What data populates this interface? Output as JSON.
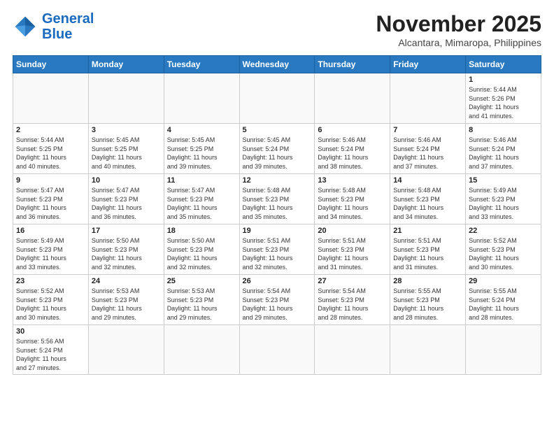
{
  "header": {
    "logo_general": "General",
    "logo_blue": "Blue",
    "month": "November 2025",
    "location": "Alcantara, Mimaropa, Philippines"
  },
  "weekdays": [
    "Sunday",
    "Monday",
    "Tuesday",
    "Wednesday",
    "Thursday",
    "Friday",
    "Saturday"
  ],
  "weeks": [
    [
      {
        "day": "",
        "info": ""
      },
      {
        "day": "",
        "info": ""
      },
      {
        "day": "",
        "info": ""
      },
      {
        "day": "",
        "info": ""
      },
      {
        "day": "",
        "info": ""
      },
      {
        "day": "",
        "info": ""
      },
      {
        "day": "1",
        "info": "Sunrise: 5:44 AM\nSunset: 5:26 PM\nDaylight: 11 hours\nand 41 minutes."
      }
    ],
    [
      {
        "day": "2",
        "info": "Sunrise: 5:44 AM\nSunset: 5:25 PM\nDaylight: 11 hours\nand 40 minutes."
      },
      {
        "day": "3",
        "info": "Sunrise: 5:45 AM\nSunset: 5:25 PM\nDaylight: 11 hours\nand 40 minutes."
      },
      {
        "day": "4",
        "info": "Sunrise: 5:45 AM\nSunset: 5:25 PM\nDaylight: 11 hours\nand 39 minutes."
      },
      {
        "day": "5",
        "info": "Sunrise: 5:45 AM\nSunset: 5:24 PM\nDaylight: 11 hours\nand 39 minutes."
      },
      {
        "day": "6",
        "info": "Sunrise: 5:46 AM\nSunset: 5:24 PM\nDaylight: 11 hours\nand 38 minutes."
      },
      {
        "day": "7",
        "info": "Sunrise: 5:46 AM\nSunset: 5:24 PM\nDaylight: 11 hours\nand 37 minutes."
      },
      {
        "day": "8",
        "info": "Sunrise: 5:46 AM\nSunset: 5:24 PM\nDaylight: 11 hours\nand 37 minutes."
      }
    ],
    [
      {
        "day": "9",
        "info": "Sunrise: 5:47 AM\nSunset: 5:23 PM\nDaylight: 11 hours\nand 36 minutes."
      },
      {
        "day": "10",
        "info": "Sunrise: 5:47 AM\nSunset: 5:23 PM\nDaylight: 11 hours\nand 36 minutes."
      },
      {
        "day": "11",
        "info": "Sunrise: 5:47 AM\nSunset: 5:23 PM\nDaylight: 11 hours\nand 35 minutes."
      },
      {
        "day": "12",
        "info": "Sunrise: 5:48 AM\nSunset: 5:23 PM\nDaylight: 11 hours\nand 35 minutes."
      },
      {
        "day": "13",
        "info": "Sunrise: 5:48 AM\nSunset: 5:23 PM\nDaylight: 11 hours\nand 34 minutes."
      },
      {
        "day": "14",
        "info": "Sunrise: 5:48 AM\nSunset: 5:23 PM\nDaylight: 11 hours\nand 34 minutes."
      },
      {
        "day": "15",
        "info": "Sunrise: 5:49 AM\nSunset: 5:23 PM\nDaylight: 11 hours\nand 33 minutes."
      }
    ],
    [
      {
        "day": "16",
        "info": "Sunrise: 5:49 AM\nSunset: 5:23 PM\nDaylight: 11 hours\nand 33 minutes."
      },
      {
        "day": "17",
        "info": "Sunrise: 5:50 AM\nSunset: 5:23 PM\nDaylight: 11 hours\nand 32 minutes."
      },
      {
        "day": "18",
        "info": "Sunrise: 5:50 AM\nSunset: 5:23 PM\nDaylight: 11 hours\nand 32 minutes."
      },
      {
        "day": "19",
        "info": "Sunrise: 5:51 AM\nSunset: 5:23 PM\nDaylight: 11 hours\nand 32 minutes."
      },
      {
        "day": "20",
        "info": "Sunrise: 5:51 AM\nSunset: 5:23 PM\nDaylight: 11 hours\nand 31 minutes."
      },
      {
        "day": "21",
        "info": "Sunrise: 5:51 AM\nSunset: 5:23 PM\nDaylight: 11 hours\nand 31 minutes."
      },
      {
        "day": "22",
        "info": "Sunrise: 5:52 AM\nSunset: 5:23 PM\nDaylight: 11 hours\nand 30 minutes."
      }
    ],
    [
      {
        "day": "23",
        "info": "Sunrise: 5:52 AM\nSunset: 5:23 PM\nDaylight: 11 hours\nand 30 minutes."
      },
      {
        "day": "24",
        "info": "Sunrise: 5:53 AM\nSunset: 5:23 PM\nDaylight: 11 hours\nand 29 minutes."
      },
      {
        "day": "25",
        "info": "Sunrise: 5:53 AM\nSunset: 5:23 PM\nDaylight: 11 hours\nand 29 minutes."
      },
      {
        "day": "26",
        "info": "Sunrise: 5:54 AM\nSunset: 5:23 PM\nDaylight: 11 hours\nand 29 minutes."
      },
      {
        "day": "27",
        "info": "Sunrise: 5:54 AM\nSunset: 5:23 PM\nDaylight: 11 hours\nand 28 minutes."
      },
      {
        "day": "28",
        "info": "Sunrise: 5:55 AM\nSunset: 5:23 PM\nDaylight: 11 hours\nand 28 minutes."
      },
      {
        "day": "29",
        "info": "Sunrise: 5:55 AM\nSunset: 5:24 PM\nDaylight: 11 hours\nand 28 minutes."
      }
    ],
    [
      {
        "day": "30",
        "info": "Sunrise: 5:56 AM\nSunset: 5:24 PM\nDaylight: 11 hours\nand 27 minutes."
      },
      {
        "day": "",
        "info": ""
      },
      {
        "day": "",
        "info": ""
      },
      {
        "day": "",
        "info": ""
      },
      {
        "day": "",
        "info": ""
      },
      {
        "day": "",
        "info": ""
      },
      {
        "day": "",
        "info": ""
      }
    ]
  ]
}
